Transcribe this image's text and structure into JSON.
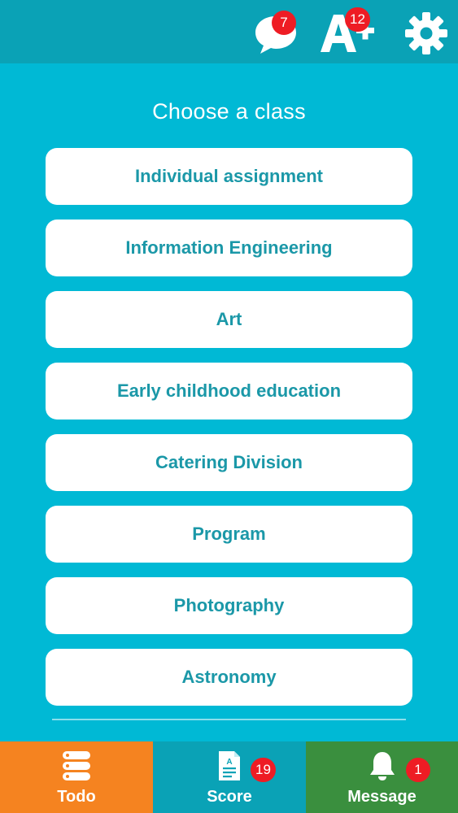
{
  "header": {
    "chat_badge": "7",
    "grades_badge": "12",
    "icons": [
      "chat-icon",
      "a-plus-icon",
      "gear-icon"
    ]
  },
  "main": {
    "title": "Choose a class",
    "classes": [
      "Individual assignment",
      "Information Engineering",
      "Art",
      "Early childhood education",
      "Catering Division",
      "Program",
      "Photography",
      "Astronomy"
    ]
  },
  "bottom_nav": {
    "todo": {
      "label": "Todo",
      "icon": "stack-icon"
    },
    "score": {
      "label": "Score",
      "badge": "19",
      "icon": "document-icon"
    },
    "message": {
      "label": "Message",
      "badge": "1",
      "icon": "bell-icon"
    }
  },
  "colors": {
    "background": "#00b9d5",
    "header": "#0aa2b6",
    "button_text": "#1b98a8",
    "badge": "#ee1c24",
    "todo_tab": "#f58320",
    "score_tab": "#0aa2b6",
    "message_tab": "#3a8f3e"
  }
}
